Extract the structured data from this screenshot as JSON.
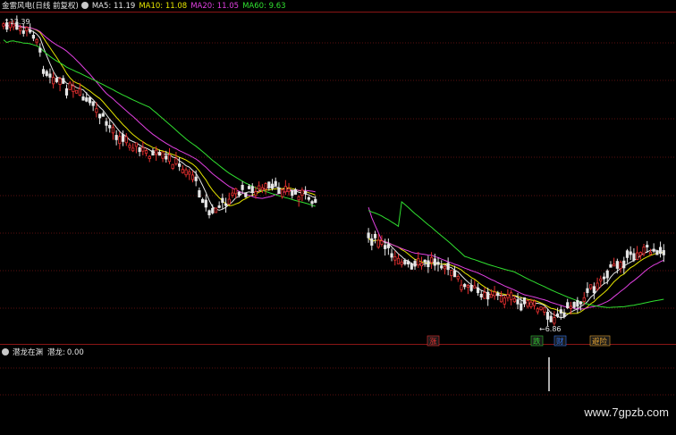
{
  "header": {
    "title": "金雷风电(日线 前复权)",
    "ma": [
      {
        "label": "MA5:",
        "value": "11.19",
        "color": "#e6e6e6"
      },
      {
        "label": "MA10:",
        "value": "11.08",
        "color": "#e6e600"
      },
      {
        "label": "MA20:",
        "value": "11.05",
        "color": "#e040e0"
      },
      {
        "label": "MA60:",
        "value": "9.63",
        "color": "#30e030"
      }
    ]
  },
  "indicator": {
    "title": "潜龙在渊",
    "label": "潜龙:",
    "value": "0.00"
  },
  "watermark": "www.7gpzb.com",
  "chart_data": {
    "type": "candlestick",
    "high_marker": "13.39",
    "low_marker": "6.86",
    "markers": [
      {
        "text": "涨",
        "color": "#e83030"
      },
      {
        "text": "跌",
        "color": "#30c030"
      },
      {
        "text": "财",
        "color": "#3070e8"
      },
      {
        "text": "避险",
        "color": "#e0a030"
      }
    ],
    "colors": {
      "up": "#e83030",
      "down": "#e6e6e6",
      "ma5": "#e6e6e6",
      "ma10": "#e6e600",
      "ma20": "#e040e0",
      "ma60": "#30e030",
      "grid": "#5a1010",
      "border": "#8a1515"
    }
  }
}
